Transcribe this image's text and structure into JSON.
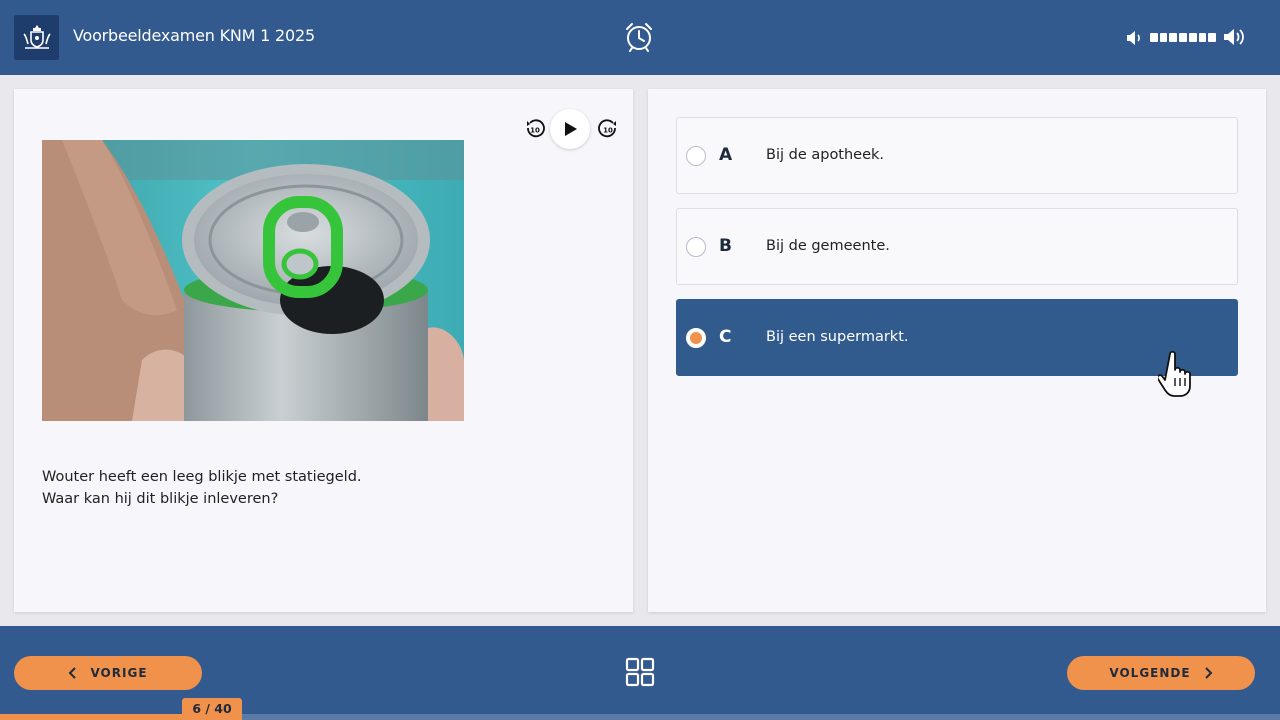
{
  "header": {
    "title": "Voorbeeldexamen KNM 1 2025",
    "logo_icon": "royal-coat-of-arms-icon",
    "timer_icon": "alarm-clock-icon",
    "volume": {
      "low_icon": "volume-low-icon",
      "high_icon": "volume-high-icon",
      "level_segments": 7
    }
  },
  "audio": {
    "rewind_label": "10",
    "forward_label": "10",
    "play_icon": "play-icon"
  },
  "question": {
    "line1": "Wouter heeft een leeg blikje met statiegeld.",
    "line2": "Waar kan hij dit blikje inleveren?"
  },
  "options": [
    {
      "letter": "A",
      "text": "Bij de apotheek.",
      "selected": false
    },
    {
      "letter": "B",
      "text": "Bij de gemeente.",
      "selected": false
    },
    {
      "letter": "C",
      "text": "Bij een supermarkt.",
      "selected": true
    }
  ],
  "footer": {
    "prev_label": "VORIGE",
    "next_label": "VOLGENDE",
    "progress_text": "6 / 40",
    "progress_fraction": 0.15,
    "overview_icon": "grid-overview-icon"
  },
  "colors": {
    "brand_blue": "#335a8f",
    "accent_orange": "#f0924c",
    "selected_option": "#315a8d"
  }
}
